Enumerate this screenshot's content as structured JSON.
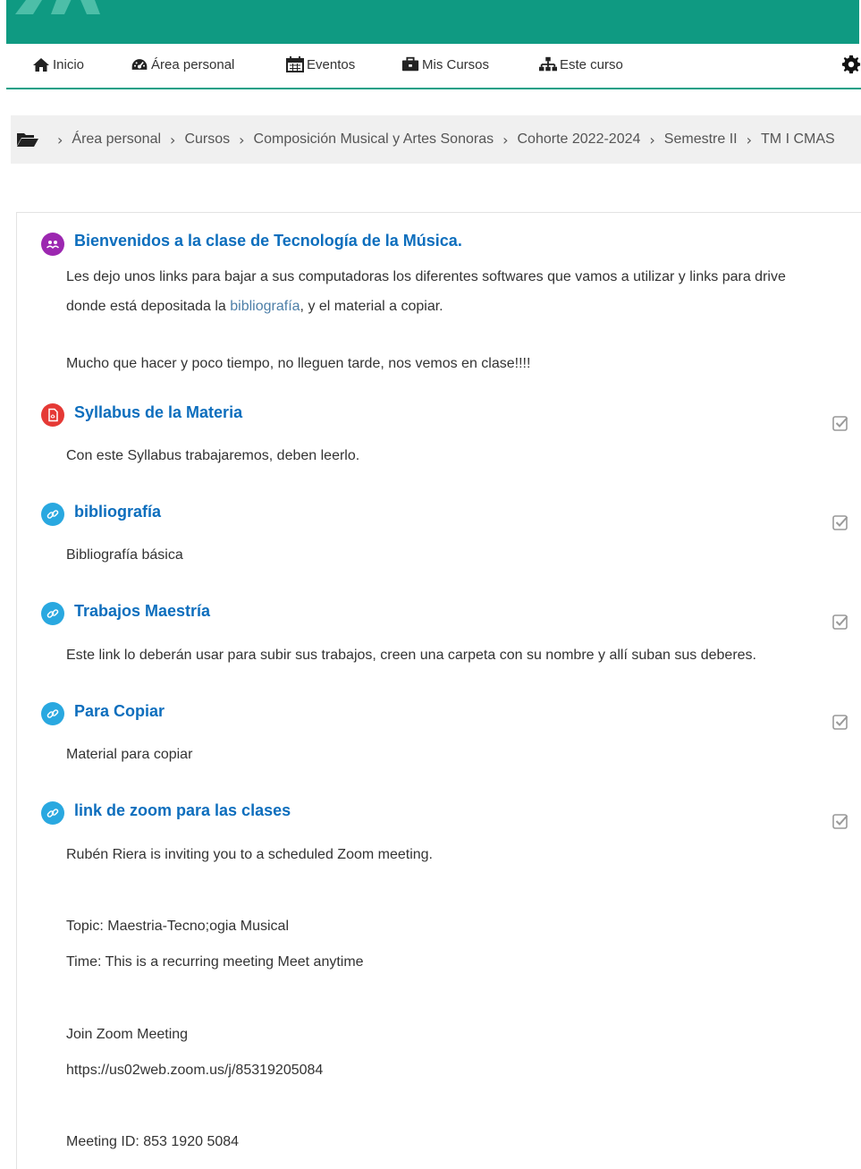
{
  "colors": {
    "topbar": "#0f9a82",
    "accent": "#12a086",
    "link": "#0d6ebd",
    "forum": "#9c27b0",
    "pdf": "#e53935",
    "url": "#29a8e0"
  },
  "nav": {
    "home": {
      "label": "Inicio",
      "icon": "home-icon"
    },
    "dashboard": {
      "label": "Área personal",
      "icon": "dashboard-icon"
    },
    "events": {
      "label": "Eventos",
      "icon": "calendar-icon"
    },
    "courses": {
      "label": "Mis Cursos",
      "icon": "briefcase-icon"
    },
    "this_course": {
      "label": "Este curso",
      "icon": "sitemap-icon"
    },
    "settings_icon": "gear-icon"
  },
  "breadcrumb": {
    "root_icon": "folder-open-icon",
    "items": [
      "Área personal",
      "Cursos",
      "Composición Musical y Artes Sonoras",
      "Cohorte 2022-2024",
      "Semestre II",
      "TM I CMAS"
    ]
  },
  "welcome": {
    "icon": "forum-icon",
    "title": "Bienvenidos a la clase de Tecnología de la Música.",
    "line1": "Les dejo unos links para bajar a sus computadoras los diferentes softwares que vamos a utilizar y links para  drive",
    "line2_prefix": "donde está depositada la ",
    "line2_link": "bibliografía",
    "line2_suffix": ", y el material a copiar.",
    "line3": "Mucho que hacer y poco tiempo, no lleguen tarde, nos vemos en clase!!!!"
  },
  "activities": [
    {
      "title": "Syllabus de la Materia",
      "icon": "pdf-icon",
      "desc": "Con este Syllabus trabajaremos, deben leerlo."
    },
    {
      "title": "bibliografía",
      "icon": "link-icon",
      "desc": "Bibliografía básica"
    },
    {
      "title": "Trabajos Maestría",
      "icon": "link-icon",
      "desc": "Este link lo deberán usar para subir sus trabajos, creen una carpeta con su nombre y allí suban sus deberes."
    },
    {
      "title": "Para Copiar",
      "icon": "link-icon",
      "desc": "Material para copiar"
    },
    {
      "title": "link de zoom para las clases",
      "icon": "link-icon",
      "desc": "Rubén Riera is inviting you to a scheduled Zoom meeting."
    }
  ],
  "zoom": {
    "topic": "Topic: Maestria-Tecno;ogia Musical",
    "time": "Time: This is a recurring meeting Meet anytime",
    "join": "Join Zoom Meeting",
    "url": "https://us02web.zoom.us/j/85319205084",
    "meeting_id": "Meeting ID: 853 1920 5084"
  }
}
